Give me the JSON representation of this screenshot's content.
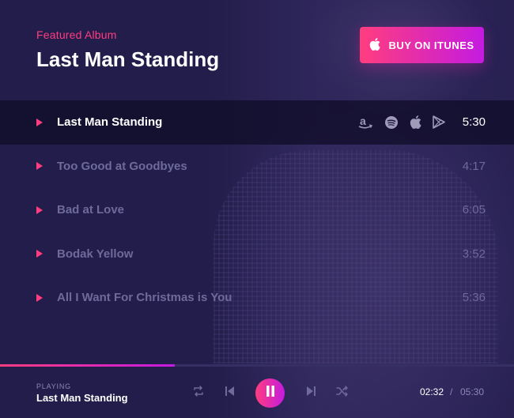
{
  "header": {
    "featured_label": "Featured Album",
    "album_title": "Last Man Standing",
    "buy_button_label": "BUY ON ITUNES"
  },
  "tracks": [
    {
      "title": "Last Man Standing",
      "duration": "5:30",
      "active": true
    },
    {
      "title": "Too Good at Goodbyes",
      "duration": "4:17",
      "active": false
    },
    {
      "title": "Bad at Love",
      "duration": "6:05",
      "active": false
    },
    {
      "title": "Bodak Yellow",
      "duration": "3:52",
      "active": false
    },
    {
      "title": "All I Want For Christmas is You",
      "duration": "5:36",
      "active": false
    }
  ],
  "service_icons": [
    "amazon-icon",
    "spotify-icon",
    "apple-icon",
    "google-play-icon"
  ],
  "player": {
    "status_label": "PLAYING",
    "now_playing": "Last Man Standing",
    "current_time": "02:32",
    "separator": "/",
    "total_time": "05:30",
    "progress_fraction": 0.34
  },
  "colors": {
    "accent_pink": "#ff3d7f",
    "accent_purple": "#c41be0",
    "background": "#231d4b"
  }
}
